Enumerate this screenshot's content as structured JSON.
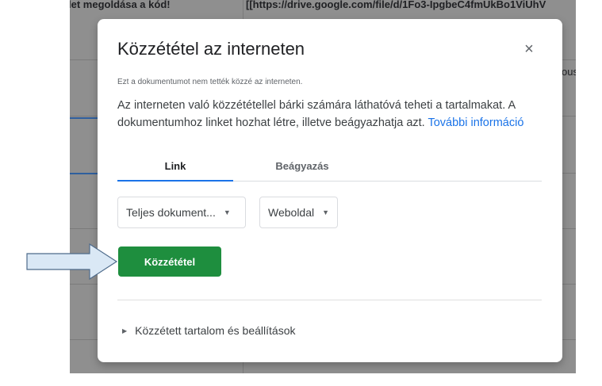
{
  "background_sheet": {
    "cell_left": "let megoldása a kód!",
    "cell_right": "[[https://drive.google.com/file/d/1Fo3-IpgbeC4fmUkBo1ViUhV",
    "cell_far_right": "ous"
  },
  "dialog": {
    "title": "Közzététel az interneten",
    "close_symbol": "×",
    "status": "Ezt a dokumentumot nem tették közzé az interneten.",
    "description": "Az interneten való közzététellel bárki számára láthatóvá teheti a tartalmakat. A dokumentumhoz linket hozhat létre, illetve beágyazhatja azt.",
    "learn_more": "További információ",
    "tabs": [
      {
        "label": "Link",
        "active": true
      },
      {
        "label": "Beágyazás",
        "active": false
      }
    ],
    "select_scope": "Teljes dokument...",
    "select_format": "Weboldal",
    "publish_button": "Közzététel",
    "published_settings": "Közzétett tartalom és beállítások"
  },
  "colors": {
    "accent_blue": "#1a73e8",
    "publish_green": "#1e8e3e",
    "overlay_gray": "#8f8f8f",
    "arrow_fill": "#dae8f5",
    "arrow_stroke": "#4e6b8b"
  }
}
